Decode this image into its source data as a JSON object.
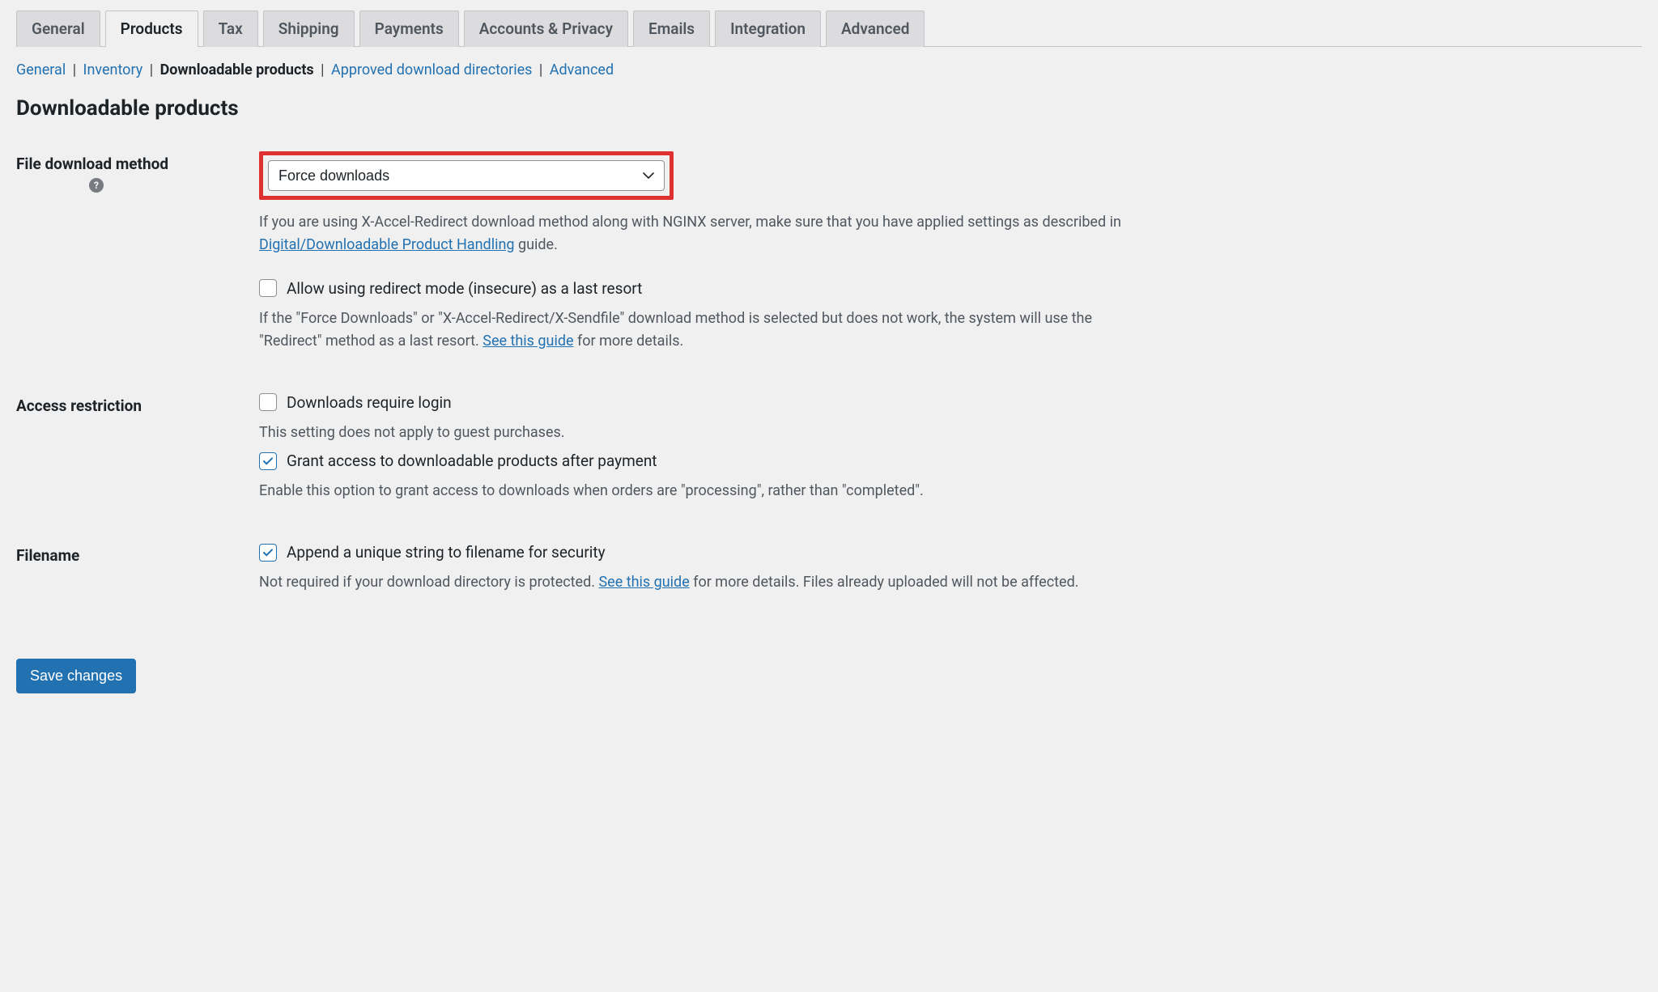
{
  "tabs": [
    "General",
    "Products",
    "Tax",
    "Shipping",
    "Payments",
    "Accounts & Privacy",
    "Emails",
    "Integration",
    "Advanced"
  ],
  "active_tab_index": 1,
  "subnav": [
    "General",
    "Inventory",
    "Downloadable products",
    "Approved download directories",
    "Advanced"
  ],
  "active_subnav_index": 2,
  "section_title": "Downloadable products",
  "file_download": {
    "label": "File download method",
    "help_glyph": "?",
    "selected": "Force downloads",
    "desc_before": "If you are using X-Accel-Redirect download method along with NGINX server, make sure that you have applied settings as described in ",
    "desc_link": "Digital/Downloadable Product Handling",
    "desc_after": " guide.",
    "allow_redirect": {
      "checked": false,
      "label": "Allow using redirect mode (insecure) as a last resort",
      "desc_before": "If the \"Force Downloads\" or \"X-Accel-Redirect/X-Sendfile\" download method is selected but does not work, the system will use the \"Redirect\" method as a last resort. ",
      "desc_link": "See this guide",
      "desc_after": " for more details."
    }
  },
  "access_restriction": {
    "label": "Access restriction",
    "require_login": {
      "checked": false,
      "label": "Downloads require login",
      "desc": "This setting does not apply to guest purchases."
    },
    "grant_access": {
      "checked": true,
      "label": "Grant access to downloadable products after payment",
      "desc": "Enable this option to grant access to downloads when orders are \"processing\", rather than \"completed\"."
    }
  },
  "filename": {
    "label": "Filename",
    "unique_string": {
      "checked": true,
      "label": "Append a unique string to filename for security",
      "desc_before": "Not required if your download directory is protected. ",
      "desc_link": "See this guide",
      "desc_after": " for more details. Files already uploaded will not be affected."
    }
  },
  "save_label": "Save changes"
}
